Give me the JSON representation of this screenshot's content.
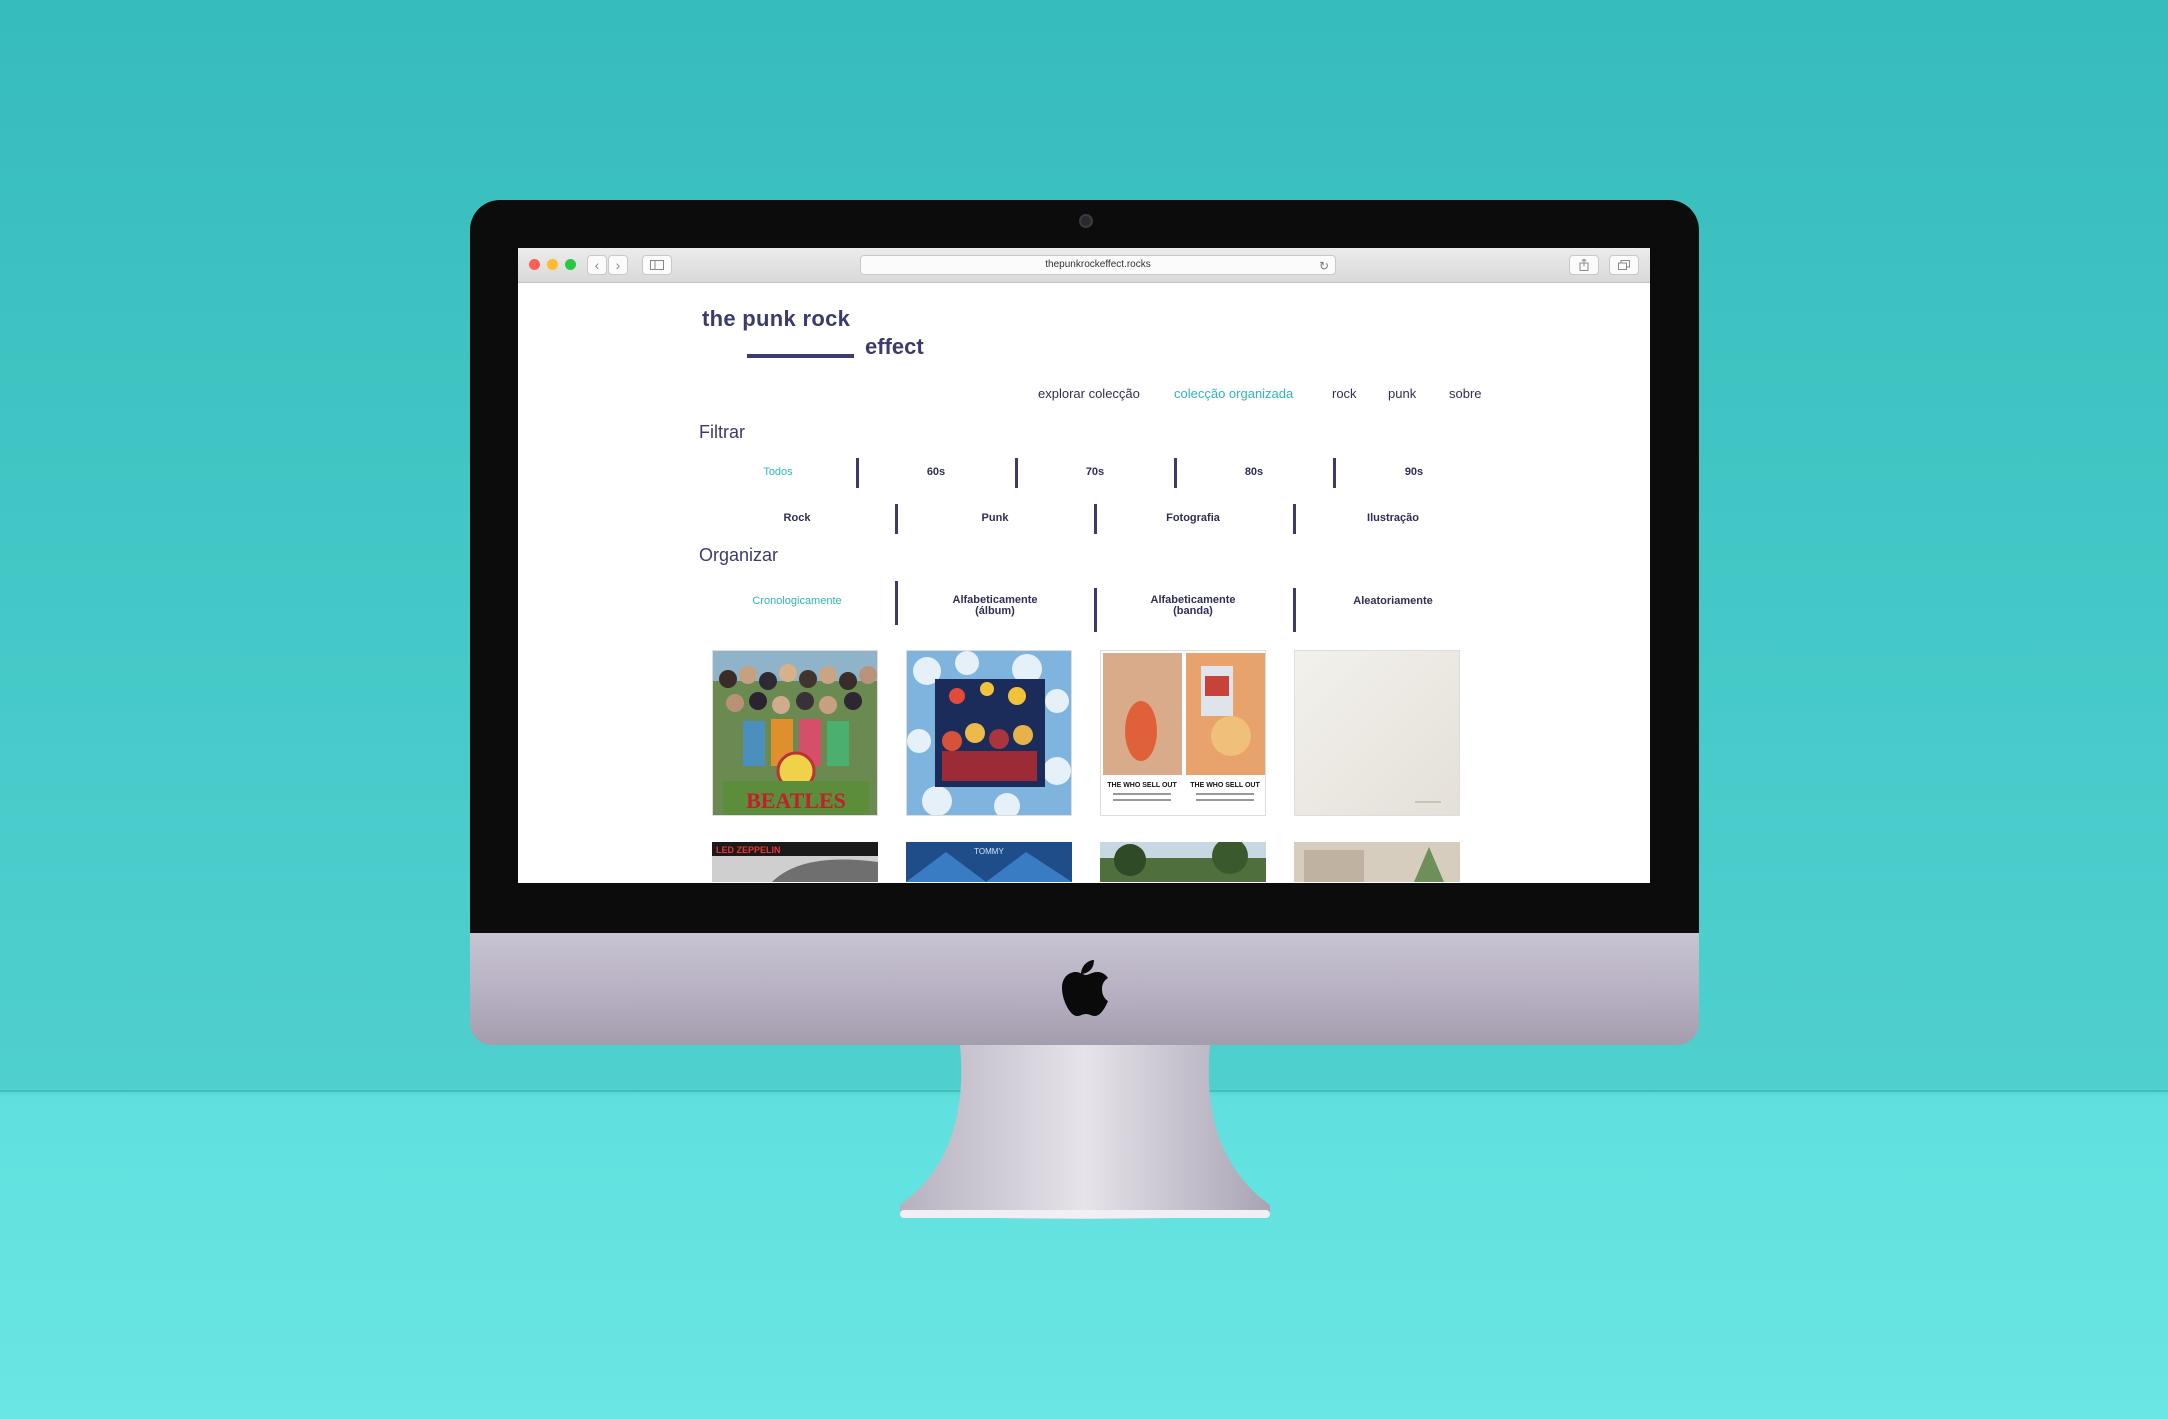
{
  "browser": {
    "url": "thepunkrockeffect.rocks",
    "back_icon": "chevron-left-icon",
    "forward_icon": "chevron-right-icon",
    "sidebar_icon": "sidebar-icon",
    "reload_icon": "reload-icon",
    "share_icon": "share-icon",
    "tabs_icon": "tabs-icon"
  },
  "site": {
    "logo_line1": "the punk rock",
    "logo_line2": "effect",
    "nav": [
      {
        "label": "explorar colecção",
        "active": false
      },
      {
        "label": "colecção organizada",
        "active": true
      },
      {
        "label": "rock",
        "active": false
      },
      {
        "label": "punk",
        "active": false
      },
      {
        "label": "sobre",
        "active": false
      }
    ],
    "filter_title": "Filtrar",
    "decades": [
      {
        "label": "Todos",
        "active": true
      },
      {
        "label": "60s",
        "active": false
      },
      {
        "label": "70s",
        "active": false
      },
      {
        "label": "80s",
        "active": false
      },
      {
        "label": "90s",
        "active": false
      }
    ],
    "genres": [
      {
        "label": "Rock"
      },
      {
        "label": "Punk"
      },
      {
        "label": "Fotografia"
      },
      {
        "label": "Ilustração"
      }
    ],
    "organize_title": "Organizar",
    "sort": [
      {
        "label": "Cronologicamente",
        "active": true
      },
      {
        "label": "Alfabeticamente (álbum)",
        "active": false
      },
      {
        "label": "Alfabeticamente (banda)",
        "active": false
      },
      {
        "label": "Aleatoriamente",
        "active": false
      }
    ],
    "covers": [
      {
        "text": "BEATLES"
      },
      {
        "text": ""
      },
      {
        "text_left": "THE WHO SELL OUT",
        "text_right": "THE WHO SELL OUT"
      },
      {
        "text": ""
      }
    ],
    "covers_row2": [
      {
        "text": "LED ZEPPELIN"
      },
      {
        "text": "TOMMY"
      },
      {
        "text": ""
      },
      {
        "text": ""
      }
    ]
  },
  "colors": {
    "accent": "#2fb6b8",
    "primary": "#3b3b6e",
    "background": "#45c9c8"
  }
}
